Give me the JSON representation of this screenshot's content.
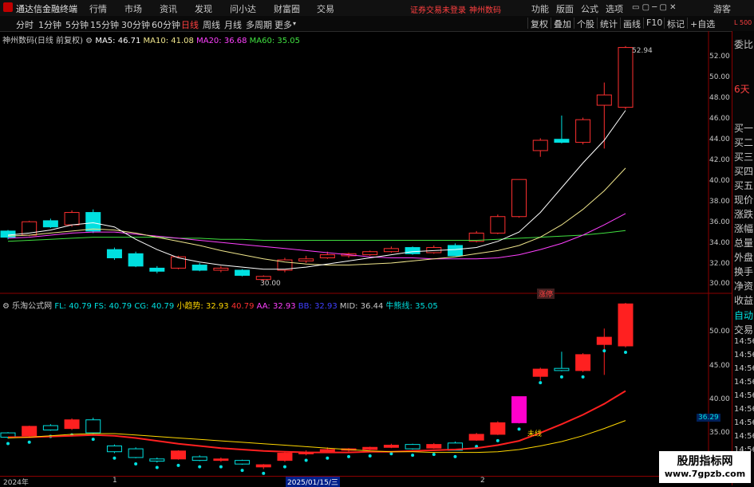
{
  "menubar": {
    "app_title": "通达信金融终端",
    "menus": [
      "行情",
      "市场",
      "资讯",
      "发现",
      "问小达",
      "财富圈",
      "交易"
    ],
    "status": "证券交易未登录",
    "stock_name": "神州数码",
    "right_menus": [
      "功能",
      "版面",
      "公式",
      "选项"
    ],
    "user": "游客"
  },
  "toolbar": {
    "periods": [
      "分时",
      "1分钟",
      "5分钟",
      "15分钟",
      "30分钟",
      "60分钟",
      "日线",
      "周线",
      "月线",
      "多周期",
      "更多"
    ],
    "selected": "日线",
    "buttons": [
      "复权",
      "叠加",
      "个股",
      "统计",
      "画线",
      "F10",
      "标记",
      "+自选"
    ]
  },
  "main": {
    "title": "神州数码(日线 前复权)",
    "ma": [
      {
        "label": "MA5: 46.71",
        "color": "#ffffff"
      },
      {
        "label": "MA10: 41.08",
        "color": "#f0e68c"
      },
      {
        "label": "MA20: 36.68",
        "color": "#ff40ff"
      },
      {
        "label": "MA60: 35.05",
        "color": "#40e040"
      }
    ],
    "high_label": "52.94",
    "low_label": "30.00",
    "limit_up_tag": "涨停",
    "y_ticks": [
      "52.00",
      "50.00",
      "48.00",
      "46.00",
      "44.00",
      "42.00",
      "40.00",
      "38.00",
      "36.00",
      "34.00",
      "32.00",
      "30.00"
    ]
  },
  "sub": {
    "title": "乐淘公式网",
    "items": [
      {
        "label": "FL: 40.79",
        "color": "#00e0e0"
      },
      {
        "label": "FS: 40.79",
        "color": "#00e0e0"
      },
      {
        "label": "CG: 40.79",
        "color": "#00e0e0"
      },
      {
        "label": "小趋势: 32.93",
        "color": "#ffd700"
      },
      {
        "label": "40.79",
        "color": "#ff3030"
      },
      {
        "label": "AA: 32.93",
        "color": "#ff40ff"
      },
      {
        "label": "BB: 32.93",
        "color": "#4040ff"
      },
      {
        "label": "MID: 36.44",
        "color": "#c8c8c8"
      },
      {
        "label": "牛熊线: 35.05",
        "color": "#00e0e0"
      }
    ],
    "y_ticks": [
      "50.00",
      "45.00",
      "40.00",
      "35.00"
    ],
    "current_value": "36.29",
    "tag": "未线"
  },
  "right_panel": {
    "ratio_label": "委比",
    "days": "6天",
    "items": [
      "买一",
      "买二",
      "买三",
      "买四",
      "买五",
      "现价",
      "涨跌",
      "涨幅",
      "总量",
      "外盘",
      "换手",
      "净资",
      "收益"
    ],
    "auto": "自动",
    "trade": "交易",
    "times": [
      "14:56",
      "14:56",
      "14:56",
      "14:56",
      "14:56",
      "14:56",
      "14:56",
      "14:56",
      "14:56"
    ],
    "top_tag": "L 500"
  },
  "time_axis": [
    "2024年",
    "1",
    "2025/01/15/三",
    "2"
  ],
  "watermark": {
    "line1": "股朋指标网",
    "line2": "www.7gpzb.com"
  },
  "chart_data": {
    "type": "candlestick",
    "candles": [
      {
        "o": 34.4,
        "c": 35.0,
        "h": 35.1,
        "l": 34.2,
        "up": false
      },
      {
        "o": 34.6,
        "c": 35.9,
        "h": 36.0,
        "l": 34.5,
        "up": true
      },
      {
        "o": 35.4,
        "c": 36.0,
        "h": 36.2,
        "l": 35.3,
        "up": false
      },
      {
        "o": 35.6,
        "c": 36.8,
        "h": 37.0,
        "l": 35.4,
        "up": true
      },
      {
        "o": 36.8,
        "c": 35.0,
        "h": 37.1,
        "l": 34.8,
        "up": false
      },
      {
        "o": 33.2,
        "c": 32.4,
        "h": 33.4,
        "l": 32.2,
        "up": false
      },
      {
        "o": 32.8,
        "c": 31.6,
        "h": 33.0,
        "l": 31.5,
        "up": false
      },
      {
        "o": 31.4,
        "c": 31.1,
        "h": 31.6,
        "l": 30.9,
        "up": false
      },
      {
        "o": 31.4,
        "c": 32.5,
        "h": 32.6,
        "l": 31.3,
        "up": true
      },
      {
        "o": 31.7,
        "c": 31.2,
        "h": 31.9,
        "l": 31.1,
        "up": false
      },
      {
        "o": 31.2,
        "c": 31.4,
        "h": 31.6,
        "l": 31.0,
        "up": true
      },
      {
        "o": 31.2,
        "c": 30.7,
        "h": 31.3,
        "l": 30.6,
        "up": false
      },
      {
        "o": 30.3,
        "c": 30.6,
        "h": 30.7,
        "l": 30.0,
        "up": true
      },
      {
        "o": 31.2,
        "c": 32.2,
        "h": 32.4,
        "l": 31.0,
        "up": true
      },
      {
        "o": 32.1,
        "c": 32.3,
        "h": 32.6,
        "l": 31.9,
        "up": true
      },
      {
        "o": 32.4,
        "c": 32.7,
        "h": 33.0,
        "l": 32.3,
        "up": true
      },
      {
        "o": 32.6,
        "c": 32.8,
        "h": 32.9,
        "l": 32.4,
        "up": true
      },
      {
        "o": 32.7,
        "c": 33.0,
        "h": 33.1,
        "l": 32.6,
        "up": true
      },
      {
        "o": 33.0,
        "c": 33.3,
        "h": 33.5,
        "l": 32.9,
        "up": true
      },
      {
        "o": 33.4,
        "c": 32.8,
        "h": 33.5,
        "l": 32.7,
        "up": false
      },
      {
        "o": 32.9,
        "c": 33.4,
        "h": 33.6,
        "l": 32.8,
        "up": true
      },
      {
        "o": 33.6,
        "c": 32.6,
        "h": 33.8,
        "l": 32.6,
        "up": false
      },
      {
        "o": 34.0,
        "c": 34.8,
        "h": 35.0,
        "l": 33.9,
        "up": true
      },
      {
        "o": 34.8,
        "c": 36.4,
        "h": 36.6,
        "l": 34.7,
        "up": true
      },
      {
        "o": 36.4,
        "c": 40.0,
        "h": 40.0,
        "l": 36.3,
        "up": true
      },
      {
        "o": 42.8,
        "c": 43.8,
        "h": 44.0,
        "l": 42.2,
        "up": true
      },
      {
        "o": 43.9,
        "c": 43.6,
        "h": 46.2,
        "l": 43.5,
        "up": false
      },
      {
        "o": 43.6,
        "c": 45.8,
        "h": 46.0,
        "l": 43.4,
        "up": true
      },
      {
        "o": 47.2,
        "c": 48.2,
        "h": 49.4,
        "l": 43.0,
        "up": true
      },
      {
        "o": 47.0,
        "c": 52.8,
        "h": 52.94,
        "l": 46.8,
        "up": true
      }
    ],
    "ma5": [
      34.6,
      34.8,
      35.1,
      35.6,
      35.8,
      35.4,
      34.2,
      33.2,
      32.4,
      32.0,
      31.7,
      31.5,
      31.3,
      31.3,
      31.5,
      31.8,
      32.1,
      32.4,
      32.7,
      33.0,
      33.1,
      33.2,
      33.4,
      34.0,
      34.9,
      36.8,
      39.2,
      41.6,
      43.8,
      46.7
    ],
    "ma10": [
      34.5,
      34.6,
      34.8,
      35.0,
      35.2,
      35.1,
      34.8,
      34.4,
      34.0,
      33.6,
      33.1,
      32.7,
      32.3,
      32.0,
      31.8,
      31.7,
      31.7,
      31.8,
      31.9,
      32.1,
      32.3,
      32.5,
      32.8,
      33.1,
      33.6,
      34.4,
      35.6,
      37.1,
      38.9,
      41.1
    ],
    "ma20": [
      34.3,
      34.4,
      34.6,
      34.8,
      34.9,
      34.9,
      34.7,
      34.5,
      34.3,
      34.1,
      33.9,
      33.7,
      33.5,
      33.3,
      33.1,
      32.9,
      32.7,
      32.5,
      32.4,
      32.4,
      32.3,
      32.3,
      32.3,
      32.4,
      32.7,
      33.2,
      33.8,
      34.6,
      35.6,
      36.7
    ],
    "ma60": [
      34.0,
      34.1,
      34.2,
      34.3,
      34.4,
      34.4,
      34.4,
      34.4,
      34.3,
      34.3,
      34.2,
      34.2,
      34.1,
      34.1,
      34.1,
      34.1,
      34.1,
      34.1,
      34.1,
      34.1,
      34.1,
      34.1,
      34.1,
      34.2,
      34.3,
      34.4,
      34.5,
      34.6,
      34.8,
      35.05
    ],
    "ylim_main": [
      29.5,
      53.0
    ],
    "ylim_sub": [
      30.5,
      52.5
    ],
    "red_line": [
      34.4,
      34.4,
      34.5,
      34.6,
      34.7,
      34.6,
      34.3,
      33.9,
      33.5,
      33.2,
      32.9,
      32.7,
      32.5,
      32.4,
      32.3,
      32.3,
      32.3,
      32.4,
      32.4,
      32.5,
      32.6,
      32.7,
      32.9,
      33.3,
      33.9,
      35.0,
      36.2,
      37.5,
      39.0,
      40.79
    ]
  }
}
